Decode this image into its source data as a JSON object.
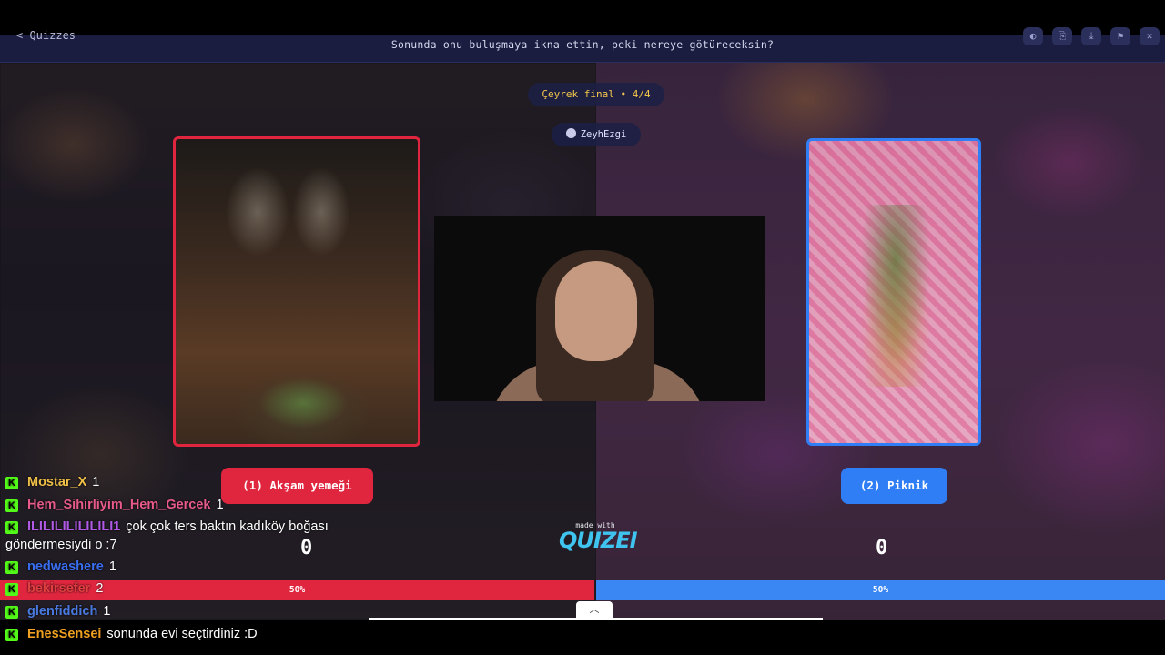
{
  "header": {
    "back_label": "< Quizzes",
    "question": "Sonunda onu buluşmaya ikna ettin, peki nereye götüreceksin?",
    "buttons": [
      "◐",
      "⎘",
      "⤓",
      "⚑",
      "✕"
    ]
  },
  "round": {
    "label": "Çeyrek final • 4/4"
  },
  "creator": {
    "name": "ZeyhEzgi"
  },
  "choices": {
    "left": {
      "label": "(1) Akşam yemeği",
      "score": "0",
      "percent_label": "50%",
      "percent": 50,
      "color": "#e0263f"
    },
    "right": {
      "label": "(2) Piknik",
      "score": "0",
      "percent_label": "50%",
      "percent": 50,
      "color": "#2f7ef5"
    }
  },
  "branding": {
    "made_with": "made with",
    "logo": "QUIZEI"
  },
  "toggle_icon": "chevron-up-icon",
  "chat": {
    "messages": [
      {
        "user": "Mostar_X",
        "text": "1",
        "color": "#f0c048"
      },
      {
        "user": "Hem_Sihirliyim_Hem_Gercek",
        "text": "1",
        "color": "#e85a8a"
      },
      {
        "user": "ILILILILILILILI1",
        "text": "çok çok ters baktın kadıköy boğası",
        "color": "#b05ae6"
      },
      {
        "user": "",
        "text": "göndermesiydi o :7",
        "color": "#ffffff"
      },
      {
        "user": "nedwashere",
        "text": "1",
        "color": "#3a6ef0"
      },
      {
        "user": "bekirsefer",
        "text": "2",
        "color": "#e04040"
      },
      {
        "user": "glenfiddich",
        "text": "1",
        "color": "#4a7ae0"
      },
      {
        "user": "EnesSensei",
        "text": "sonunda evi seçtirdiniz :D",
        "color": "#f0a020"
      }
    ]
  }
}
